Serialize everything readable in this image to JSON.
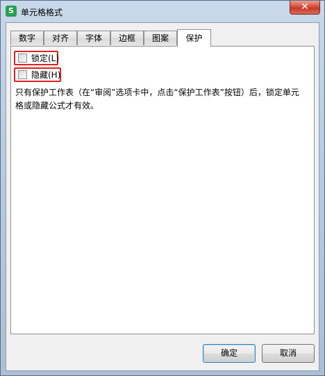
{
  "window": {
    "title": "单元格格式",
    "app_icon_glyph": "S",
    "close_glyph": "✕"
  },
  "tabs": [
    {
      "label": "数字",
      "active": false
    },
    {
      "label": "对齐",
      "active": false
    },
    {
      "label": "字体",
      "active": false
    },
    {
      "label": "边框",
      "active": false
    },
    {
      "label": "图案",
      "active": false
    },
    {
      "label": "保护",
      "active": true
    }
  ],
  "protection": {
    "locked": {
      "label": "锁定(L)",
      "checked": false
    },
    "hidden": {
      "label": "隐藏(H)",
      "checked": false
    },
    "description": "只有保护工作表（在“审阅”选项卡中，点击“保护工作表”按钮）后，锁定单元格或隐藏公式才有效。"
  },
  "buttons": {
    "ok": "确定",
    "cancel": "取消"
  },
  "colors": {
    "highlight_border": "#e02020",
    "app_icon_green": "#23a04e",
    "close_red": "#c7382a"
  },
  "icons": {
    "app_icon": "wps-spreadsheet-icon",
    "close": "close-icon"
  }
}
